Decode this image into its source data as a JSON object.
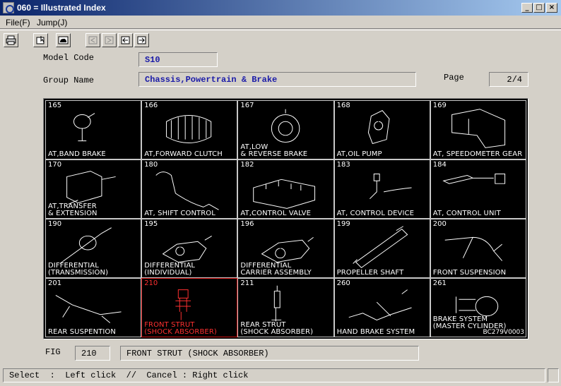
{
  "window": {
    "title": "060 = Illustrated Index"
  },
  "menu": {
    "file": "File(F)",
    "jump": "Jump(J)"
  },
  "form": {
    "model_code_label": "Model Code",
    "model_code_value": "S10",
    "group_name_label": "Group Name",
    "group_name_value": "Chassis,Powertrain & Brake",
    "page_label": "Page",
    "page_value": "2/4",
    "fig_label": "FIG",
    "fig_number": "210",
    "fig_name": "FRONT STRUT (SHOCK ABSORBER)"
  },
  "grid": {
    "selected_color": "#ff3030",
    "cells": [
      {
        "num": "165",
        "name": "AT,BAND BRAKE"
      },
      {
        "num": "166",
        "name": "AT,FORWARD CLUTCH"
      },
      {
        "num": "167",
        "name": "AT,LOW\n& REVERSE BRAKE"
      },
      {
        "num": "168",
        "name": "AT,OIL PUMP"
      },
      {
        "num": "169",
        "name": "AT, SPEEDOMETER GEAR"
      },
      {
        "num": "170",
        "name": "AT,TRANSFER\n& EXTENSION"
      },
      {
        "num": "180",
        "name": "AT, SHIFT CONTROL"
      },
      {
        "num": "182",
        "name": "AT,CONTROL VALVE"
      },
      {
        "num": "183",
        "name": "AT, CONTROL DEVICE"
      },
      {
        "num": "184",
        "name": "AT, CONTROL UNIT"
      },
      {
        "num": "190",
        "name": "DIFFERENTIAL\n(TRANSMISSION)"
      },
      {
        "num": "195",
        "name": "DIFFERENTIAL\n(INDIVIDUAL)"
      },
      {
        "num": "196",
        "name": "DIFFERENTIAL\nCARRIER ASSEMBLY"
      },
      {
        "num": "199",
        "name": "PROPELLER SHAFT"
      },
      {
        "num": "200",
        "name": "FRONT SUSPENSION"
      },
      {
        "num": "201",
        "name": "REAR SUSPENTION"
      },
      {
        "num": "210",
        "name": "FRONT STRUT\n(SHOCK ABSORBER)",
        "selected": true
      },
      {
        "num": "211",
        "name": "REAR STRUT\n(SHOCK ABSORBER)"
      },
      {
        "num": "260",
        "name": "HAND BRAKE SYSTEM"
      },
      {
        "num": "261",
        "name": "BRAKE SYSTEM\n(MASTER CYLINDER)",
        "code": "BC279V0003"
      }
    ]
  },
  "status": {
    "text": "Select  :  Left click  //  Cancel : Right click"
  }
}
